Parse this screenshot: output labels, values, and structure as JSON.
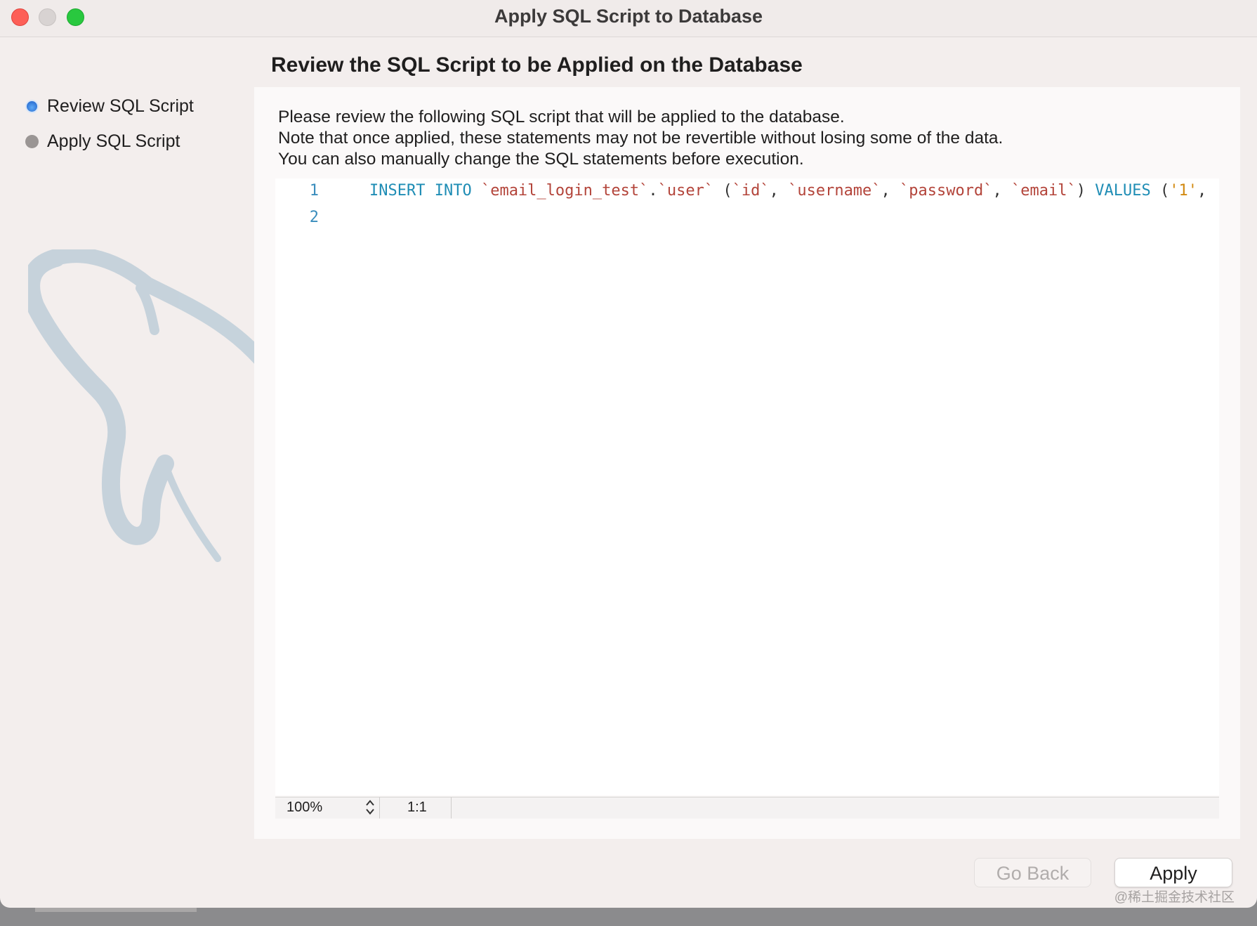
{
  "window": {
    "title": "Apply SQL Script to Database"
  },
  "heading": "Review the SQL Script to be Applied on the Database",
  "steps": [
    {
      "label": "Review SQL Script",
      "state": "active"
    },
    {
      "label": "Apply SQL Script",
      "state": "inactive"
    }
  ],
  "description": [
    "Please review the following SQL script that will be applied to the database.",
    "Note that once applied, these statements may not be revertible without losing some of the data.",
    "You can also manually change the SQL statements before execution."
  ],
  "editor": {
    "lines": [
      {
        "number": "1",
        "tokens": [
          {
            "text": "INSERT INTO ",
            "type": "kw"
          },
          {
            "text": "`email_login_test`",
            "type": "str"
          },
          {
            "text": ".",
            "type": "plain"
          },
          {
            "text": "`user`",
            "type": "str"
          },
          {
            "text": " (",
            "type": "plain"
          },
          {
            "text": "`id`",
            "type": "str"
          },
          {
            "text": ", ",
            "type": "plain"
          },
          {
            "text": "`username`",
            "type": "str"
          },
          {
            "text": ", ",
            "type": "plain"
          },
          {
            "text": "`password`",
            "type": "str"
          },
          {
            "text": ", ",
            "type": "plain"
          },
          {
            "text": "`email`",
            "type": "str"
          },
          {
            "text": ") ",
            "type": "plain"
          },
          {
            "text": "VALUES",
            "type": "kw"
          },
          {
            "text": " (",
            "type": "plain"
          },
          {
            "text": "'1'",
            "type": "val"
          },
          {
            "text": ",",
            "type": "plain"
          }
        ]
      },
      {
        "number": "2",
        "tokens": []
      }
    ],
    "zoom": "100%",
    "cursor_position": "1:1"
  },
  "buttons": {
    "go_back": "Go Back",
    "apply": "Apply"
  },
  "watermark": "@稀土掘金技术社区",
  "icons": {
    "zoom_stepper": "chevron-up-down-icon",
    "logo": "mysql-dolphin-logo"
  },
  "colors": {
    "keyword": "#1f8db5",
    "identifier": "#b3443a",
    "value": "#d28a12",
    "line_number": "#3a8dbd"
  }
}
